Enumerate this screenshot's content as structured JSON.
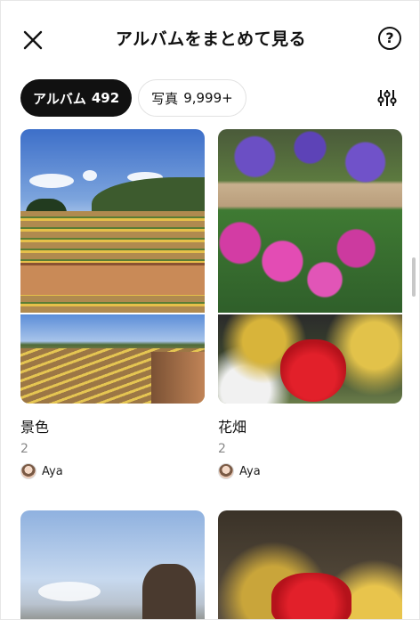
{
  "header": {
    "title": "アルバムをまとめて見る",
    "help_label": "?"
  },
  "tabs": [
    {
      "label": "アルバム",
      "count": "492",
      "active": true
    },
    {
      "label": "写真",
      "count": "9,999+",
      "active": false
    }
  ],
  "albums": [
    {
      "name": "景色",
      "count": "2",
      "owner": "Aya"
    },
    {
      "name": "花畑",
      "count": "2",
      "owner": "Aya"
    }
  ],
  "colors": {
    "active_tab_bg": "#111111",
    "active_tab_text": "#ffffff",
    "muted_text": "#888888"
  },
  "icons": {
    "close": "close-icon",
    "help": "help-icon",
    "filter": "sliders-icon"
  }
}
